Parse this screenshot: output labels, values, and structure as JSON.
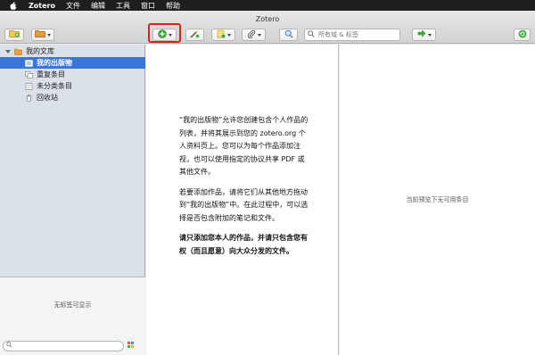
{
  "menubar": {
    "app_name": "Zotero",
    "items": [
      "文件",
      "编辑",
      "工具",
      "窗口",
      "帮助"
    ]
  },
  "window": {
    "title": "Zotero"
  },
  "toolbar": {
    "search_placeholder": "所有域 & 标签",
    "accent_color": "#e02020"
  },
  "sidebar": {
    "library_label": "我的文库",
    "items": [
      {
        "label": "我的出版物",
        "selected": true
      },
      {
        "label": "重复条目",
        "selected": false
      },
      {
        "label": "未分类条目",
        "selected": false
      },
      {
        "label": "回收站",
        "selected": false
      }
    ],
    "selection_color": "#3875d7"
  },
  "tag_pane": {
    "empty_text": "无标签可显示"
  },
  "main": {
    "paragraphs": [
      "“我的出版物”允许您创建包含个人作品的列表，并将其展示到您的 zotero.org 个人资料页上。您可以为每个作品添加注视，也可以使用指定的协议共享 PDF 或其他文件。",
      "若要添加作品，请将它们从其他地方拖动到“我的出版物”中。在此过程中，可以选择是否包含附加的笔记和文件。",
      "请只添加您本人的作品，并请只包含您有权（而且愿意）向大众分发的文件。"
    ]
  },
  "preview": {
    "empty_text": "当前预览下无可用条目"
  }
}
